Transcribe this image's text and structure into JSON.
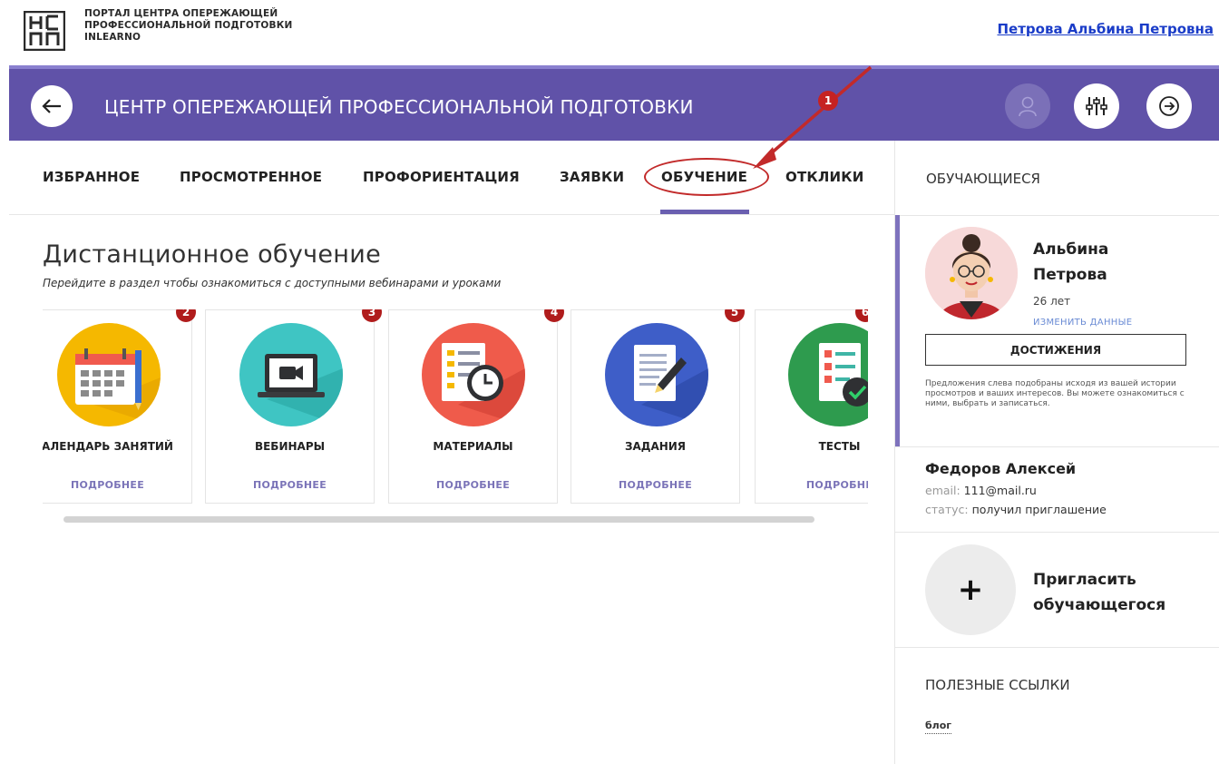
{
  "header": {
    "portal_line1": "ПОРТАЛ ЦЕНТРА ОПЕРЕЖАЮЩЕЙ",
    "portal_line2": "ПРОФЕССИОНАЛЬНОЙ ПОДГОТОВКИ",
    "portal_line3": "INLEARNO",
    "user_link": "Петрова Альбина Петровна"
  },
  "bar": {
    "title": "ЦЕНТР ОПЕРЕЖАЮЩЕЙ ПРОФЕССИОНАЛЬНОЙ ПОДГОТОВКИ",
    "marker": "1"
  },
  "tabs": [
    {
      "label": "ИЗБРАННОЕ"
    },
    {
      "label": "ПРОСМОТРЕННОЕ"
    },
    {
      "label": "ПРОФОРИЕНТАЦИЯ"
    },
    {
      "label": "ЗАЯВКИ"
    },
    {
      "label": "ОБУЧЕНИЕ",
      "active": true
    },
    {
      "label": "ОТКЛИКИ"
    }
  ],
  "main": {
    "title": "Дистанционное обучение",
    "subtitle": "Перейдите в раздел чтобы ознакомиться с доступными вебинарами и уроками",
    "cards": [
      {
        "label": "АЛЕНДАРЬ ЗАНЯТИЙ",
        "more": "ПОДРОБНЕЕ",
        "badge": "2",
        "icon": "calendar-icon",
        "color": "#f5b800"
      },
      {
        "label": "ВЕБИНАРЫ",
        "more": "ПОДРОБНЕЕ",
        "badge": "3",
        "icon": "laptop-camera-icon",
        "color": "#3fc5c3"
      },
      {
        "label": "МАТЕРИАЛЫ",
        "more": "ПОДРОБНЕЕ",
        "badge": "4",
        "icon": "document-clock-icon",
        "color": "#ef5b4b"
      },
      {
        "label": "ЗАДАНИЯ",
        "more": "ПОДРОБНЕЕ",
        "badge": "5",
        "icon": "document-pen-icon",
        "color": "#3e5ec8"
      },
      {
        "label": "ТЕСТЫ",
        "more": "ПОДРОБНЕ",
        "badge": "6",
        "icon": "checklist-icon",
        "color": "#2e9b4e"
      }
    ]
  },
  "sidebar": {
    "heading": "ОБУЧАЮЩИЕСЯ",
    "profile": {
      "first_name": "Альбина",
      "last_name": "Петрова",
      "age": "26 лет",
      "edit": "ИЗМЕНИТЬ ДАННЫЕ",
      "achievements": "ДОСТИЖЕНИЯ",
      "note": "Предложения слева подобраны исходя из вашей истории просмотров и ваших интересов. Вы можете ознакомиться с ними, выбрать и записаться."
    },
    "student": {
      "name": "Федоров Алексей",
      "email_label": "email:",
      "email": "111@mail.ru",
      "status_label": "статус:",
      "status": "получил приглашение"
    },
    "invite": {
      "plus": "+",
      "line1": "Пригласить",
      "line2": "обучающегося"
    },
    "links_heading": "ПОЛЕЗНЫЕ ССЫЛКИ",
    "blog": "блог"
  },
  "colors": {
    "purple": "#6052a8",
    "badge_red": "#b01c1c",
    "link_blue": "#1a3cc8"
  }
}
